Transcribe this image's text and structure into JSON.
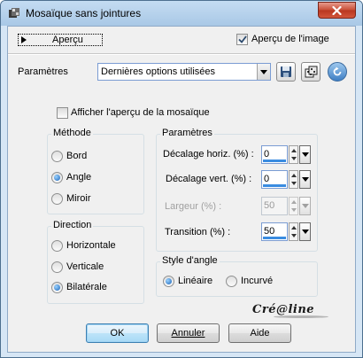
{
  "window": {
    "title": "Mosaïque sans jointures",
    "close_label": "✕"
  },
  "preview": {
    "toggle_label": "Aperçu",
    "show_image_label": "Aperçu de l'image",
    "show_image_checked": true
  },
  "presets": {
    "label": "Paramètres",
    "selected": "Dernières options utilisées",
    "icons": [
      "save-icon",
      "randomize-dice-icon",
      "reset-icon"
    ]
  },
  "tile_preview": {
    "label": "Afficher l'aperçu de la mosaïque",
    "checked": false
  },
  "method": {
    "title": "Méthode",
    "options": [
      "Bord",
      "Angle",
      "Miroir"
    ],
    "selected": "Angle"
  },
  "direction": {
    "title": "Direction",
    "options": [
      "Horizontale",
      "Verticale",
      "Bilatérale"
    ],
    "selected": "Bilatérale"
  },
  "parameters": {
    "title": "Paramètres",
    "fields": [
      {
        "label": "Décalage horiz. (%) :",
        "value": "0",
        "enabled": true
      },
      {
        "label": "Décalage vert. (%) :",
        "value": "0",
        "enabled": true
      },
      {
        "label": "Largeur (%) :",
        "value": "50",
        "enabled": false
      },
      {
        "label": "Transition (%) :",
        "value": "50",
        "enabled": true
      }
    ]
  },
  "corner_style": {
    "title": "Style d'angle",
    "options": [
      "Linéaire",
      "Incurvé"
    ],
    "selected": "Linéaire"
  },
  "watermark": "Cré@line",
  "buttons": {
    "ok": "OK",
    "cancel": "Annuler",
    "help": "Aide"
  },
  "colors": {
    "accent": "#3a8ce0",
    "titlebar": "#b9d5ef",
    "close": "#c84c34"
  }
}
